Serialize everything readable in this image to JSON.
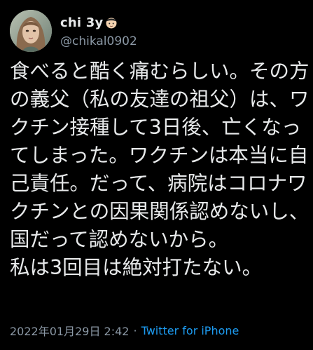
{
  "colors": {
    "background": "#000000",
    "text": "#e7e9ea",
    "muted": "#8b98a5",
    "link": "#1d9bf0"
  },
  "author": {
    "display_name": "chi 3y",
    "badge_icon": "face-emoji-icon",
    "handle": "@chikal0902",
    "avatar_icon": "profile-avatar"
  },
  "tweet": {
    "text": "食べると酷く痛むらしい。その方の義父（私の友達の祖父）は、ワクチン接種して3日後、亡くなってしまった。ワクチンは本当に自己責任。だって、病院はコロナワクチンとの因果関係認めないし、国だって認めないから。\n私は3回目は絶対打たない。",
    "timestamp": "2022年01月29日 2:42",
    "separator": "·",
    "source": "Twitter for iPhone"
  }
}
